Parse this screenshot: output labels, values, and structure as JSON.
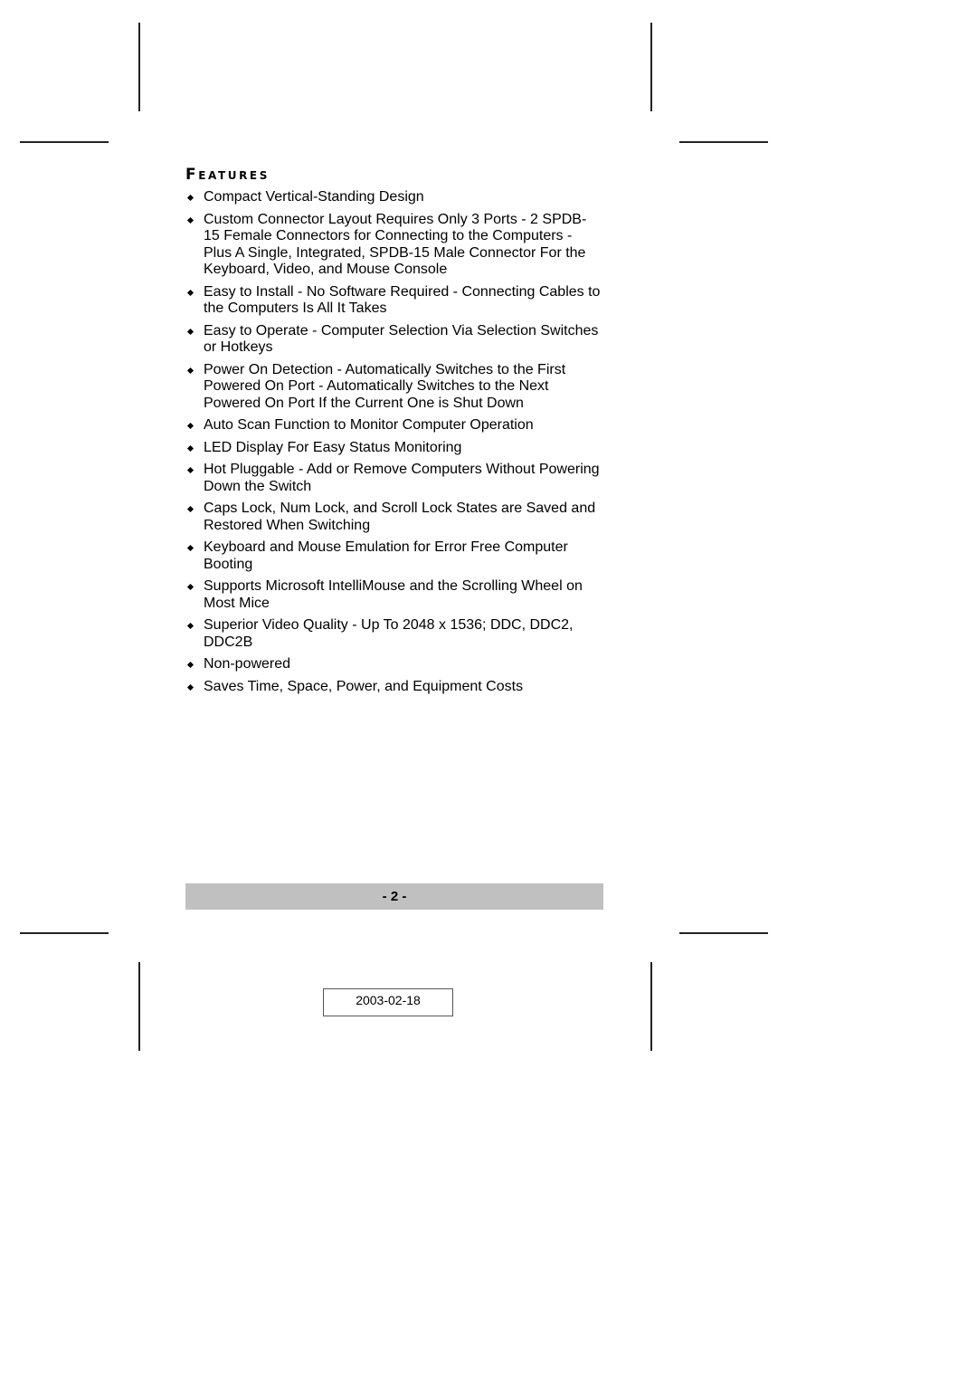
{
  "section": {
    "heading": "Features"
  },
  "features": [
    {
      "text": "Compact Vertical-Standing Design"
    },
    {
      "text": "Custom Connector Layout Requires Only 3 Ports - 2 SPDB-15 Female Connectors for Connecting to the Computers - Plus A Single, Integrated, SPDB-15 Male Connector For the Keyboard, Video, and Mouse Console"
    },
    {
      "text": "Easy to Install - No Software Required - Connecting Cables to the Computers Is All It Takes"
    },
    {
      "text": "Easy to Operate - Computer Selection Via Selection Switches or Hotkeys"
    },
    {
      "text": "Power On Detection - Automatically Switches to the First Powered On Port - Automatically Switches to the Next Powered On Port If the Current One is Shut Down"
    },
    {
      "text": "Auto Scan Function to Monitor Computer Operation"
    },
    {
      "text": "LED Display For Easy Status Monitoring"
    },
    {
      "text": "Hot Pluggable - Add or Remove Computers Without Powering Down the Switch"
    },
    {
      "text": "Caps Lock, Num Lock, and Scroll Lock States are Saved and Restored When Switching"
    },
    {
      "text": "Keyboard and Mouse Emulation for Error Free Computer Booting"
    },
    {
      "text": "Supports Microsoft IntelliMouse and the Scrolling Wheel on Most Mice"
    },
    {
      "text": "Superior Video Quality - Up To 2048 x 1536; DDC, DDC2, DDC2B"
    },
    {
      "text": "Non-powered"
    },
    {
      "text": "Saves Time, Space, Power, and Equipment Costs"
    }
  ],
  "footer": {
    "page_number": "- 2 -",
    "date": "2003-02-18",
    "bar_color": "#c0c0c0"
  },
  "bullet_icon": "diamond-bullet-icon"
}
